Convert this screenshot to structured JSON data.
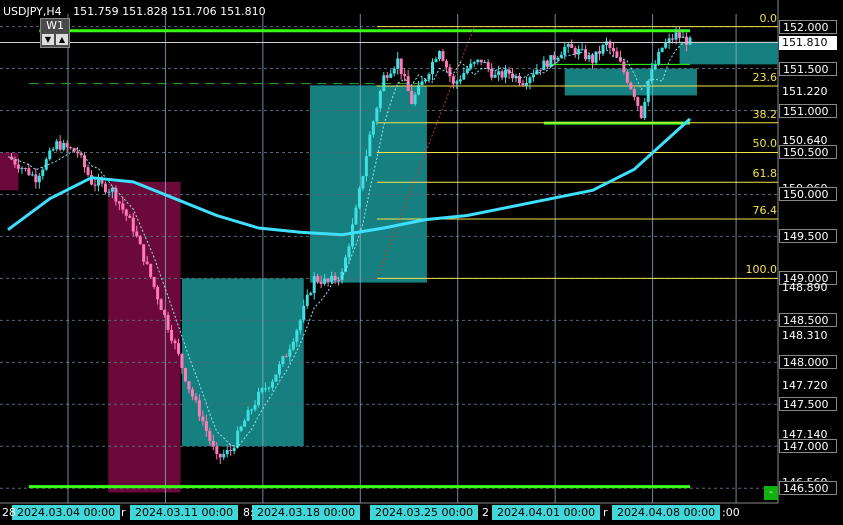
{
  "header": {
    "symbol": "USDJPY,H4",
    "ohlc": "151.759 151.828 151.706 151.810"
  },
  "timeframe": {
    "label": "W1",
    "up_icon": "triangle-down-icon",
    "down_icon": "triangle-up-icon"
  },
  "price_axis": {
    "labels": [
      "152.000",
      "151.810",
      "151.500",
      "151.220",
      "151.000",
      "150.640",
      "150.500",
      "150.060",
      "150.000",
      "149.500",
      "149.000",
      "148.890",
      "148.500",
      "148.310",
      "148.000",
      "147.720",
      "147.500",
      "147.140",
      "147.000",
      "146.560",
      "146.500"
    ],
    "current_price": "151.810"
  },
  "fib_levels": {
    "labels": [
      "0.0",
      "23.6",
      "38.2",
      "50.0",
      "61.8",
      "76.4",
      "100.0"
    ]
  },
  "time_axis": {
    "tags": [
      "2024.03.04 00:00",
      "2024.03.11 00:00",
      "2024.03.18 00:00",
      "2024.03.25 00:00",
      "2024.04.01 00:00",
      "2024.04.08 00:00"
    ],
    "fragments": [
      "28",
      "r",
      "8:",
      "2",
      "r",
      ":00"
    ]
  },
  "corner_button": {
    "label": "-"
  },
  "colors": {
    "background": "#000000",
    "bull_candle": "#3fe0e0",
    "bear_candle": "#ff7ab6",
    "bull_zone": "#168080",
    "bear_zone": "#6b0a3a",
    "moving_average": "#3fe0ff",
    "fib_line": "#f2e24a",
    "green_line": "#39ff14",
    "grid": "#556677"
  },
  "chart_data": {
    "type": "candlestick",
    "symbol": "USDJPY",
    "timeframe": "H4",
    "ylim": [
      146.36,
      152.15
    ],
    "x": [
      "2024.03.04 00:00",
      "2024.03.11 00:00",
      "2024.03.18 00:00",
      "2024.03.25 00:00",
      "2024.04.01 00:00",
      "2024.04.08 00:00"
    ],
    "close_path": [
      [
        0,
        150.45
      ],
      [
        4,
        150.2
      ],
      [
        7,
        150.6
      ],
      [
        10,
        150.5
      ],
      [
        12,
        150.15
      ],
      [
        15,
        150.05
      ],
      [
        18,
        149.6
      ],
      [
        21,
        148.9
      ],
      [
        24,
        148.2
      ],
      [
        26,
        147.7
      ],
      [
        28,
        147.3
      ],
      [
        30,
        146.85
      ],
      [
        32,
        146.95
      ],
      [
        34,
        147.3
      ],
      [
        36,
        147.6
      ],
      [
        38,
        147.8
      ],
      [
        40,
        148.1
      ],
      [
        42,
        148.5
      ],
      [
        44,
        149.0
      ],
      [
        46,
        148.95
      ],
      [
        48,
        149.05
      ],
      [
        50,
        149.8
      ],
      [
        52,
        150.7
      ],
      [
        54,
        151.4
      ],
      [
        56,
        151.6
      ],
      [
        58,
        151.1
      ],
      [
        60,
        151.4
      ],
      [
        62,
        151.75
      ],
      [
        64,
        151.3
      ],
      [
        66,
        151.5
      ],
      [
        68,
        151.6
      ],
      [
        70,
        151.4
      ],
      [
        72,
        151.45
      ],
      [
        74,
        151.35
      ],
      [
        76,
        151.5
      ],
      [
        78,
        151.6
      ],
      [
        80,
        151.75
      ],
      [
        82,
        151.7
      ],
      [
        84,
        151.6
      ],
      [
        86,
        151.8
      ],
      [
        88,
        151.55
      ],
      [
        90,
        151.2
      ],
      [
        91,
        150.95
      ],
      [
        92,
        151.35
      ],
      [
        94,
        151.75
      ],
      [
        96,
        151.9
      ],
      [
        98,
        151.81
      ]
    ],
    "moving_average": [
      [
        0,
        149.58
      ],
      [
        6,
        149.95
      ],
      [
        12,
        150.2
      ],
      [
        18,
        150.15
      ],
      [
        24,
        149.95
      ],
      [
        30,
        149.75
      ],
      [
        36,
        149.6
      ],
      [
        42,
        149.55
      ],
      [
        48,
        149.52
      ],
      [
        54,
        149.6
      ],
      [
        60,
        149.7
      ],
      [
        66,
        149.75
      ],
      [
        72,
        149.85
      ],
      [
        78,
        149.95
      ],
      [
        84,
        150.05
      ],
      [
        90,
        150.3
      ],
      [
        98,
        150.9
      ]
    ],
    "fibonacci": {
      "high": 152.0,
      "low": 149.0,
      "levels": [
        0.0,
        23.6,
        38.2,
        50.0,
        61.8,
        76.4,
        100.0
      ]
    },
    "horizontal_lines": [
      151.95,
      146.52,
      151.32
    ],
    "last_price": 151.81
  }
}
